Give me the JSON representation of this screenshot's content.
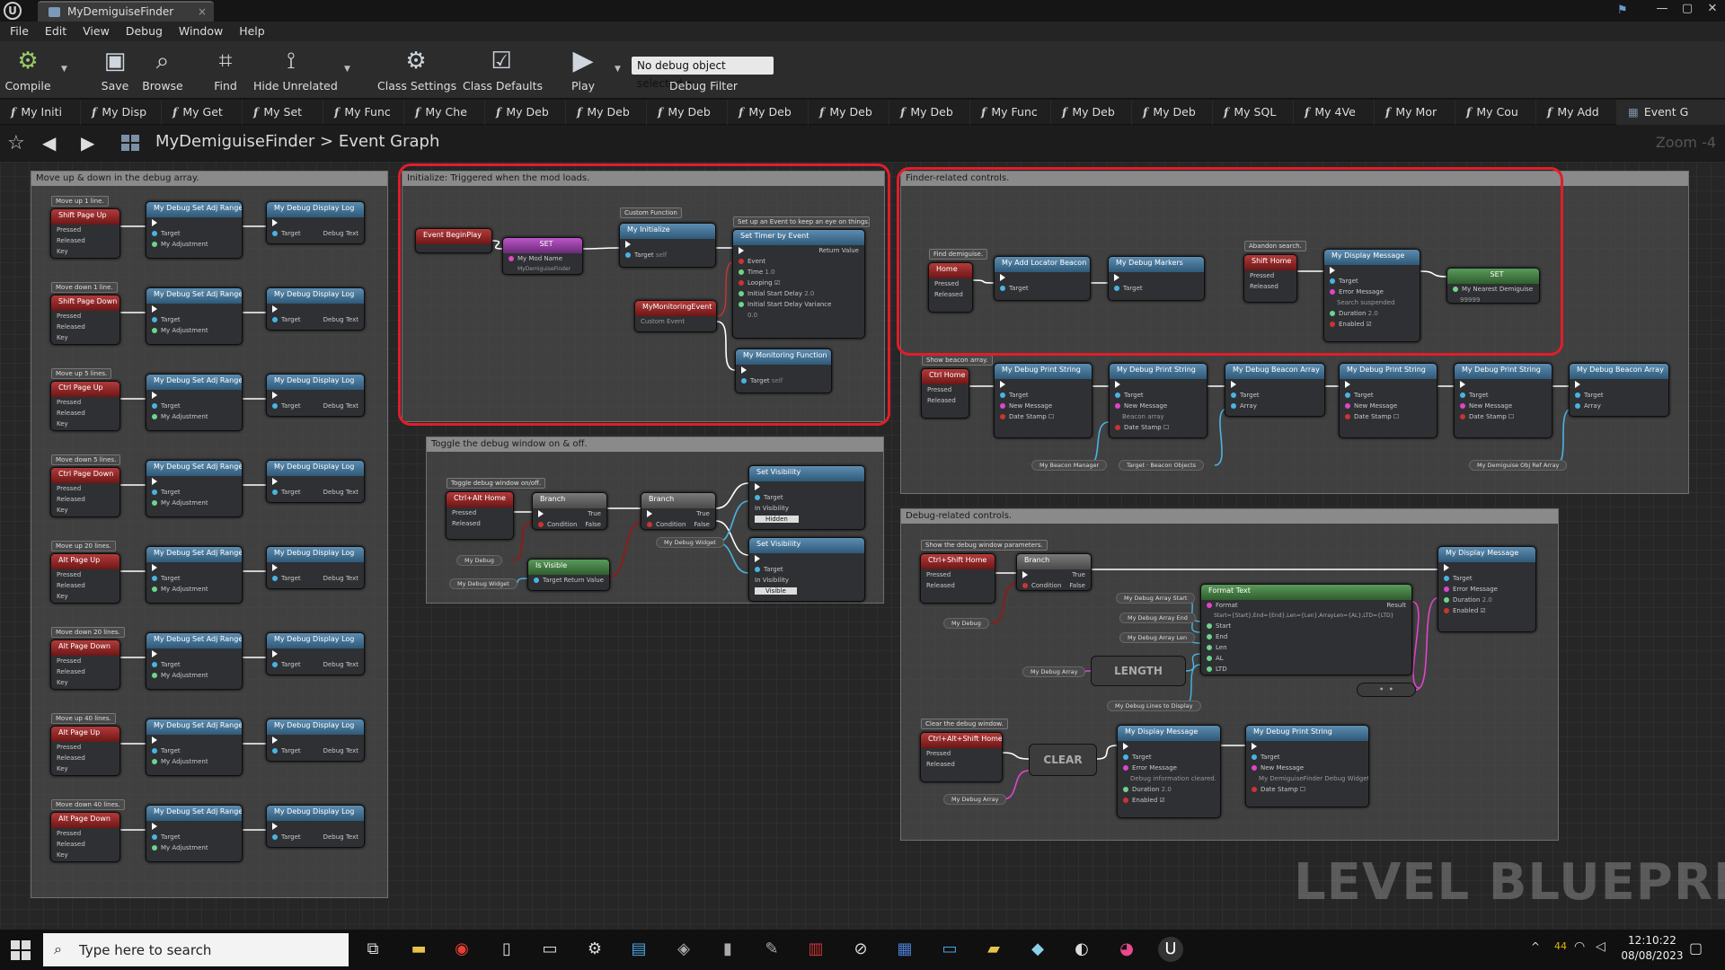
{
  "window": {
    "app_logo": "U",
    "tab_title": "MyDemiguiseFinder",
    "close_glyph": "×",
    "controls": [
      "—",
      "▢",
      "✕"
    ]
  },
  "menu": [
    "File",
    "Edit",
    "View",
    "Debug",
    "Window",
    "Help"
  ],
  "toolbar": {
    "compile": "Compile",
    "save": "Save",
    "browse": "Browse",
    "find": "Find",
    "hide_unrelated": "Hide Unrelated",
    "class_settings": "Class Settings",
    "class_defaults": "Class Defaults",
    "play": "Play",
    "debug_object": "No debug object selected ▾",
    "debug_filter": "Debug Filter"
  },
  "function_tabs": [
    "My Initi",
    "My Disp",
    "My Get",
    "My Set",
    "My Func",
    "My Che",
    "My Deb",
    "My Deb",
    "My Deb",
    "My Deb",
    "My Deb",
    "My Deb",
    "My Func",
    "My Deb",
    "My Deb",
    "My SQL",
    "My 4Ve",
    "My Mor",
    "My Cou",
    "My Add"
  ],
  "event_graph_tab": "Event G",
  "breadcrumb": {
    "root": "MyDemiguiseFinder",
    "separator": ">",
    "current": "Event Graph",
    "zoom": "Zoom -4"
  },
  "graph": {
    "comments": {
      "left": "Move up & down in the debug array.",
      "init": "Initialize: Triggered when the mod loads.",
      "finder": "Finder-related controls.",
      "toggle": "Toggle the debug window on & off.",
      "debug": "Debug-related controls."
    },
    "watermark": "LEVEL BLUEPRINT",
    "left_rows": [
      {
        "tag": "Move up 1 line.",
        "key": "Shift Page Up"
      },
      {
        "tag": "Move down 1 line.",
        "key": "Shift Page Down"
      },
      {
        "tag": "Move up 5 lines.",
        "key": "Ctrl Page Up"
      },
      {
        "tag": "Move down 5 lines.",
        "key": "Ctrl Page Down"
      },
      {
        "tag": "Move up 20 lines.",
        "key": "Alt Page Up"
      },
      {
        "tag": "Move down 20 lines.",
        "key": "Alt Page Down"
      },
      {
        "tag": "Move up 40 lines.",
        "key": "Alt Page Up"
      },
      {
        "tag": "Move down 40 lines.",
        "key": "Alt Page Down"
      }
    ],
    "left_node_titles": {
      "adj": "My Debug Set Adj Range",
      "log": "My Debug Display Log"
    },
    "pins": {
      "pressed": "Pressed",
      "released": "Released",
      "key": "Key",
      "target": "Target",
      "self": "self",
      "my_adjustment": "My Adjustment",
      "debug_text": "Debug Text",
      "condition": "Condition",
      "true": "True",
      "false": "False",
      "return_value": "Return Value",
      "array": "Array"
    },
    "init": {
      "begin_play": "Event BeginPlay",
      "set": "SET",
      "my_mod_name": "My Mod Name",
      "my_mod_name_value": "MyDemiguiseFinder",
      "custom_function_tag": "Custom Function",
      "my_initialize": "My Initialize",
      "set_up_tag": "Set up an Event to keep an eye on things...",
      "set_timer": "Set Timer by Event",
      "event": "Event",
      "time": "Time",
      "time_value": "1.0",
      "looping": "Looping",
      "initial_start_delay": "Initial Start Delay",
      "initial_start_delay_value": "2.0",
      "initial_start_delay_variance": "Initial Start Delay Variance",
      "variance_value": "0.0",
      "monitoring_event": "MyMonitoringEvent",
      "custom_event": "Custom Event",
      "monitoring_function": "My Monitoring Function"
    },
    "finder": {
      "find_tag": "Find demiguise.",
      "home_key": "Home",
      "add_locator": "My Add Locator Beacon",
      "debug_markers": "My Debug Markers",
      "abandon_tag": "Abandon search.",
      "shift_home": "Shift Home",
      "display_message": "My Display Message",
      "error_message": "Error Message",
      "search_suspended": "Search suspended",
      "duration": "Duration",
      "duration_value": "2.0",
      "enabled": "Enabled",
      "set": "SET",
      "my_nearest_demiguise": "My Nearest Demiguise",
      "nearest_value": "99999",
      "beacon_tag": "Show beacon array.",
      "ctrl_home": "Ctrl Home",
      "print_string": "My Debug Print String",
      "beacon_array": "My Debug Beacon Array",
      "new_message": "New Message",
      "date_stamp": "Date Stamp",
      "beacon_array_value": "Beacon array",
      "my_beacon_manager": "My Beacon Manager",
      "beacon_objects": "Beacon Objects",
      "my_demiguise_obj_ref": "My Demiguise Obj Ref Array"
    },
    "toggle": {
      "tag": "Toggle debug window on/off.",
      "ctrl_alt_home": "Ctrl+Alt Home",
      "branch": "Branch",
      "my_debug": "My Debug",
      "my_debug_widget": "My Debug Widget",
      "is_visible": "Is Visible",
      "set_visibility": "Set Visibility",
      "in_visibility": "In Visibility",
      "hidden": "Hidden",
      "visible": "Visible"
    },
    "debug": {
      "tag": "Show the debug window parameters.",
      "ctrl_shift_home": "Ctrl+Shift Home",
      "format_text": "Format Text",
      "format": "Format",
      "format_value": "Start={Start},End={End},Len={Len},ArrayLen={AL},LTD={LTD}",
      "result": "Result",
      "start": "Start",
      "end": "End",
      "len": "Len",
      "al": "AL",
      "ltd": "LTD",
      "array_start": "My Debug Array Start",
      "array_end": "My Debug Array End",
      "array_len": "My Debug Array Len",
      "my_debug_array": "My Debug Array",
      "length": "LENGTH",
      "lines_to_display": "My Debug Lines to Display",
      "clear_tag": "Clear the debug window.",
      "ctrl_alt_shift_home": "Ctrl+Alt+Shift Home",
      "clear": "CLEAR",
      "info_cleared": "Debug information cleared.",
      "print_string": "My Debug Print String",
      "cleared_msg": "My DemiguiseFinder Debug Widget"
    }
  },
  "taskbar": {
    "search_placeholder": "Type here to search",
    "tray_count": "44",
    "time": "12:10:22",
    "date": "08/08/2023"
  },
  "colors": {
    "highlight": "#e01e2a",
    "function_header": "#3d6e91",
    "event_header": "#9a2a2a",
    "exec_wire": "#ffffff",
    "object_wire": "#49b4e4",
    "string_wire": "#e045c8",
    "bool_wire": "#8c1c1c"
  }
}
